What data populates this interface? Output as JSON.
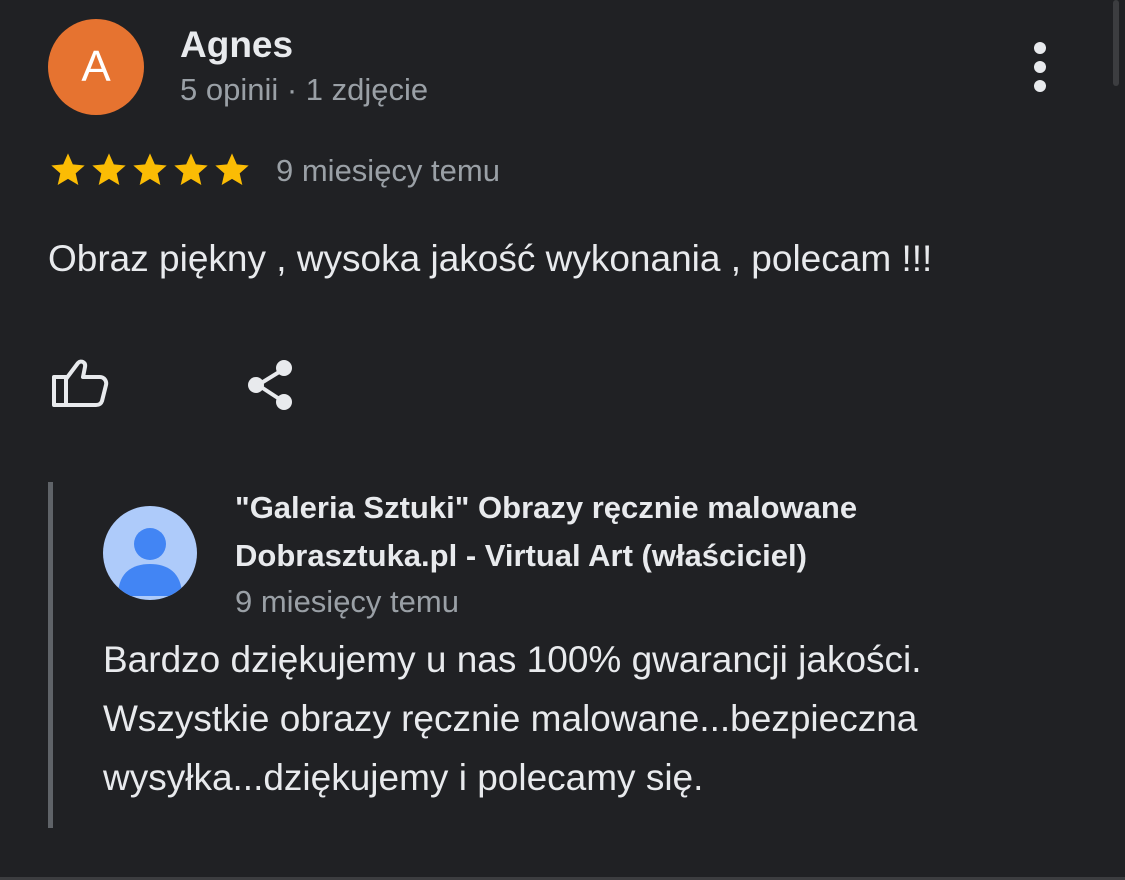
{
  "review": {
    "avatar_letter": "A",
    "reviewer_name": "Agnes",
    "reviewer_meta": "5 opinii · 1 zdjęcie",
    "rating": 5,
    "rating_max": 5,
    "time": "9 miesięcy temu",
    "text": "Obraz piękny , wysoka jakość wykonania , polecam !!!"
  },
  "owner_response": {
    "name_line1": "\"Galeria Sztuki\" Obrazy ręcznie malowane",
    "name_line2": "Dobrasztuka.pl - Virtual Art (właściciel)",
    "time": "9 miesięcy temu",
    "text_line1": "Bardzo dziękujemy u nas 100% gwarancji jakości.",
    "text_line2": "Wszystkie obrazy ręcznie malowane...bezpieczna",
    "text_line3": "wysyłka...dziękujemy i polecamy się."
  },
  "icons": {
    "more": "more-vert-icon",
    "like": "thumb-up-icon",
    "share": "share-icon",
    "owner_avatar": "default-person-avatar"
  },
  "colors": {
    "background": "#202124",
    "avatar_orange": "#e67330",
    "star_yellow": "#fbbc04",
    "text_primary": "#e8eaed",
    "text_secondary": "#9aa0a6",
    "owner_avatar_bg": "#aecbfa",
    "owner_avatar_fg": "#4285f4"
  }
}
